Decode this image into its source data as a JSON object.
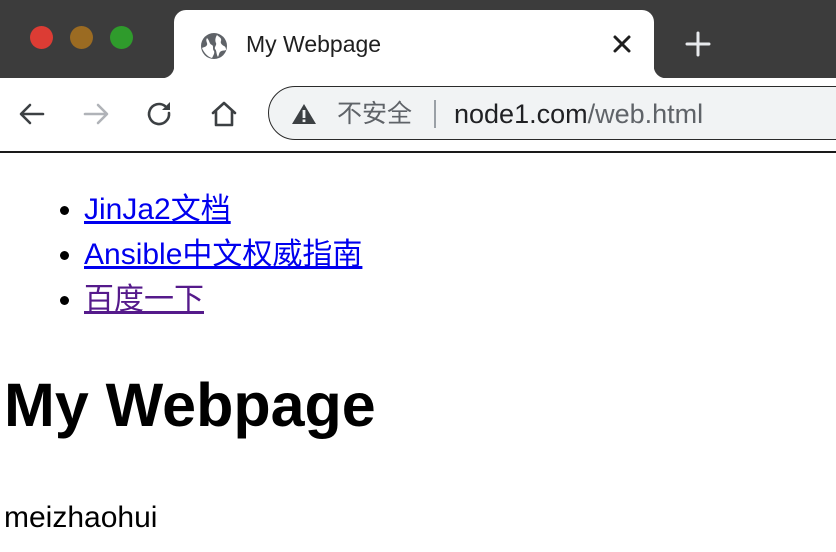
{
  "window": {
    "traffic_lights": [
      "close",
      "minimize",
      "zoom"
    ]
  },
  "tab": {
    "favicon": "globe-icon",
    "title": "My Webpage",
    "close_icon": "close-icon"
  },
  "new_tab_icon": "plus-icon",
  "toolbar": {
    "back_icon": "back-arrow-icon",
    "forward_icon": "forward-arrow-icon",
    "reload_icon": "reload-icon",
    "home_icon": "home-icon"
  },
  "omnibox": {
    "security_icon": "warning-icon",
    "security_label": "不安全",
    "url_host": "node1.com",
    "url_path": "/web.html"
  },
  "page": {
    "links": [
      {
        "label": "JinJa2文档",
        "visited": false
      },
      {
        "label": "Ansible中文权威指南",
        "visited": false
      },
      {
        "label": "百度一下",
        "visited": true
      }
    ],
    "heading": "My Webpage",
    "paragraph": "meizhaohui"
  },
  "colors": {
    "tabstrip": "#3c3c3c",
    "link": "#0000ee",
    "visited_link": "#551a8b",
    "traffic_red": "#dc3c34",
    "traffic_yellow": "#9b6b22",
    "traffic_green": "#2f9b2c"
  }
}
